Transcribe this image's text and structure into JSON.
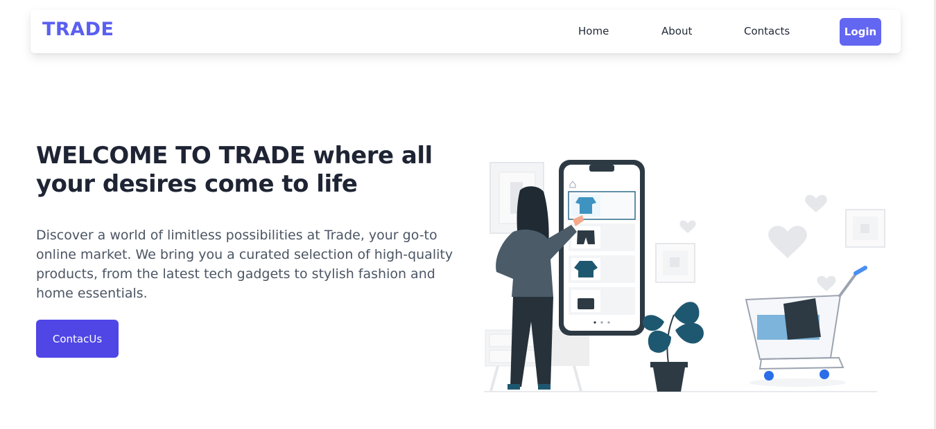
{
  "nav": {
    "logo": "TRADE",
    "links": [
      "Home",
      "About",
      "Contacts"
    ],
    "login_label": "Login"
  },
  "hero": {
    "title": "WELCOME TO TRADE where all your desires come to life",
    "description": "Discover a world of limitless possibilities at Trade, your go-to online market. We bring you a curated selection of high-quality products, from the latest tech gadgets to stylish fashion and home essentials.",
    "cta_label": "ContacUs"
  },
  "colors": {
    "brand": "#5b5ff0",
    "login_bg": "#6366f1",
    "cta_bg": "#4f46e5",
    "heading": "#1e2433",
    "body_text": "#4b5563"
  },
  "icons": [
    "shopping-cart-icon",
    "heart-icon",
    "home-icon"
  ]
}
